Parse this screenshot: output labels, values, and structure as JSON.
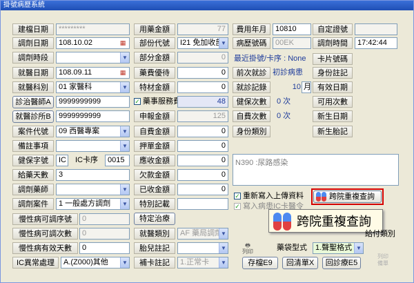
{
  "window": {
    "title": "掛號病歷系統"
  },
  "left": {
    "build_date": {
      "label": "建檔日期",
      "value": "*********"
    },
    "dispense_date": {
      "label": "調劑日期",
      "value": "108.10.02"
    },
    "dispense_period": {
      "label": "調劑時段",
      "value": ""
    },
    "visit_date": {
      "label": "就醫日期",
      "value": "108.09.11"
    },
    "dept": {
      "label": "就醫科別",
      "value": "01 家醫科"
    },
    "doctor_btn": "診治醫師A",
    "doctor_value": "9999999999",
    "clinic_btn": "就醫診所B",
    "clinic_value": "9999999999",
    "case_type": {
      "label": "案件代號",
      "value": "09 西醫專案"
    },
    "remark": {
      "label": "備註事項",
      "value": ""
    },
    "insurance": {
      "label": "健保字號",
      "value": "IC",
      "card_seq_label": "IC卡序",
      "card_seq_value": "0015"
    },
    "days": {
      "label": "給藥天數",
      "value": "3"
    },
    "pharmacist": {
      "label": "調劑藥師",
      "value": ""
    },
    "dispense_case": {
      "label": "調劑案件",
      "value": "1 一般處方調劑"
    },
    "chronic_no": {
      "label": "慢性病可調序號",
      "value": "0"
    },
    "chronic_times": {
      "label": "慢性病可調次數",
      "value": "0"
    },
    "chronic_days": {
      "label": "慢性病有效天數",
      "value": "0"
    },
    "ic_abnormal": {
      "label": "IC異常處理",
      "value": "A.(Z000)其他"
    }
  },
  "middle": {
    "fee_total": {
      "label": "用藥金額",
      "value": "77"
    },
    "part_code": {
      "label": "部份代號",
      "value": "I21 免加收部"
    },
    "part_amount": {
      "label": "部分金額",
      "value": "0"
    },
    "drug_discount": {
      "label": "藥費優待",
      "value": "0"
    },
    "special_amount": {
      "label": "特材金額",
      "value": "0"
    },
    "service_fee": {
      "label": "藥事服務費",
      "value": "48",
      "checked": "✓"
    },
    "declare_amount": {
      "label": "申報金額",
      "value": "125"
    },
    "self_amount": {
      "label": "自費金額",
      "value": "0"
    },
    "deposit": {
      "label": "押單金額",
      "value": "0"
    },
    "received": {
      "label": "應收金額",
      "value": "0"
    },
    "owed": {
      "label": "欠款金額",
      "value": "0"
    },
    "collected": {
      "label": "已收金額",
      "value": "0"
    },
    "special_record": {
      "label": "特別記載",
      "value": ""
    },
    "special_btn": "特定治療",
    "medical_type": {
      "label": "就醫類別",
      "value": "AF 藥局調劑"
    },
    "birth_note": {
      "label": "胎兒註記",
      "value": ""
    },
    "card_note": {
      "label": "補卡註記",
      "value": "1.正常卡"
    }
  },
  "right": {
    "fee_month": {
      "label": "費用年月",
      "value": "10810"
    },
    "self_cert": {
      "label": "自定證號",
      "value": ""
    },
    "record_no": {
      "label": "病歷號碼",
      "value": "00EK"
    },
    "dispense_time": {
      "label": "調劑時間",
      "value": "17:42:44"
    },
    "recent_card": "最近掛號/卡序 : None",
    "card_no_label": "卡片號碼",
    "prev_visit": {
      "label": "前次就診",
      "value": "初診病患"
    },
    "id_note_label": "身份註記",
    "visit_record": {
      "label": "就診記錄",
      "value": "10",
      "unit": "月"
    },
    "valid_date_label": "有效日期",
    "ins_count": {
      "label": "健保次數",
      "value": "0 次"
    },
    "usable_count_label": "可用次數",
    "self_count": {
      "label": "自費次數",
      "value": "0 次"
    },
    "newborn_date_label": "新生日期",
    "id_category_label": "身份類別",
    "newborn_note_label": "新生胎記",
    "diagnosis": "N390 :尿路感染",
    "reupload": "重新寫入上傳資料",
    "write_card": "寫入病患IC卡醫令",
    "cross_query_btn": "跨院重複查詢",
    "cross_query_popup": "跨院重複查詢",
    "pay_label": "給付類別",
    "bag_label": "藥袋型式",
    "bag_value": "1.聲聖格式",
    "print_label": "列印",
    "save_btn": "存檔E9",
    "back_btn": "回清單X",
    "return_btn": "回診療E5",
    "logo_text": "列印\n備單"
  },
  "colors": {
    "accent_red": "#d40000",
    "blue_text": "#1e3c9b"
  }
}
